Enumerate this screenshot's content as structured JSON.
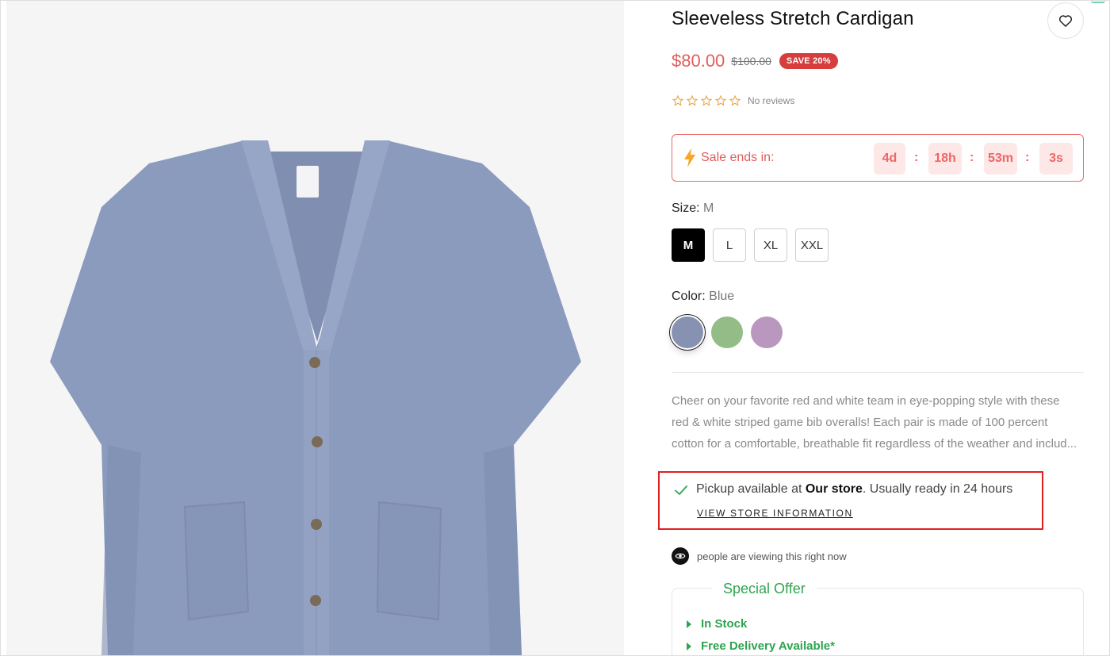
{
  "product": {
    "title": "Sleeveless Stretch Cardigan",
    "image_icon": "cardigan-product-photo",
    "image_bg_color": "#f5f5f6",
    "garment_color": "#8a9bbd"
  },
  "price": {
    "current": "$80.00",
    "compare_at": "$100.00",
    "badge": "SAVE 20%",
    "current_color": "#e05d5d",
    "badge_color": "#d63d3d"
  },
  "rating": {
    "stars_filled": 0,
    "stars_total": 5,
    "text": "No reviews",
    "star_color": "#e6a23c"
  },
  "sale": {
    "label": "Sale ends in:",
    "icon": "lightning-bolt-icon",
    "days": "4d",
    "hours": "18h",
    "minutes": "53m",
    "seconds": "3s",
    "separator": ":"
  },
  "size": {
    "label": "Size:",
    "selected": "M",
    "options": [
      "M",
      "L",
      "XL",
      "XXL"
    ]
  },
  "color": {
    "label": "Color:",
    "selected": "Blue",
    "swatches": [
      {
        "name": "Blue",
        "hex": "#8792b3"
      },
      {
        "name": "Green",
        "hex": "#93bc86"
      },
      {
        "name": "Purple",
        "hex": "#b997be"
      }
    ]
  },
  "description": "Cheer on your favorite red and white team in eye-popping style with these red & white striped game bib overalls! Each pair is made of 100 percent cotton for a comfortable, breathable fit regardless of the weather and includ...",
  "pickup": {
    "prefix": "Pickup available at ",
    "store": "Our store",
    "suffix": ". Usually ready in 24 hours",
    "link": "VIEW STORE INFORMATION"
  },
  "viewers": {
    "text": "people are viewing this right now"
  },
  "offer": {
    "title": "Special Offer",
    "items": [
      "In Stock",
      "Free Delivery Available*"
    ],
    "accent": "#2ea44f"
  }
}
